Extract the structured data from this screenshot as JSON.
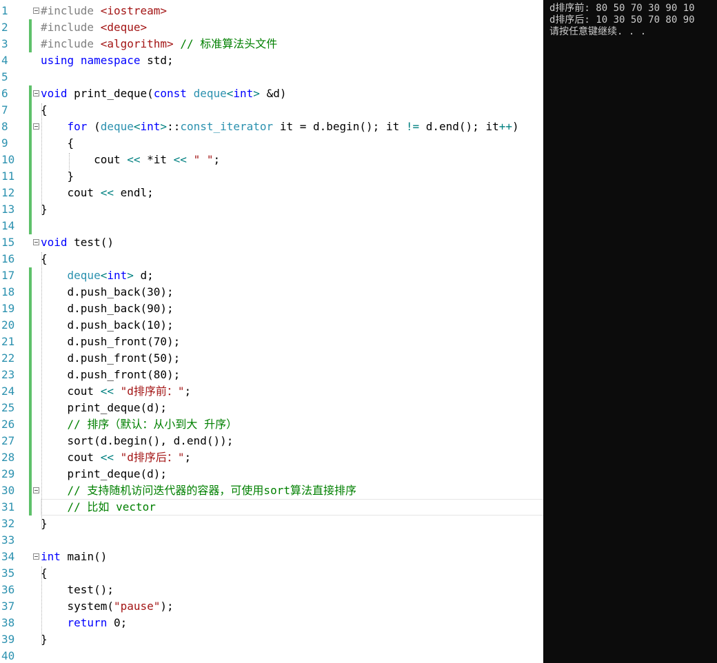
{
  "editor": {
    "lines": [
      {
        "n": "1",
        "text": "#include <iostream>",
        "fold": true,
        "green": false
      },
      {
        "n": "2",
        "text": "#include <deque>",
        "fold": false,
        "green": true
      },
      {
        "n": "3",
        "text": "#include <algorithm> // 标准算法头文件",
        "fold": false,
        "green": true
      },
      {
        "n": "4",
        "text": "using namespace std;",
        "fold": false,
        "green": false
      },
      {
        "n": "5",
        "text": "",
        "fold": false,
        "green": false
      },
      {
        "n": "6",
        "text": "void print_deque(const deque<int> &d)",
        "fold": true,
        "green": true
      },
      {
        "n": "7",
        "text": "{",
        "fold": false,
        "green": true
      },
      {
        "n": "8",
        "text": "    for (deque<int>::const_iterator it = d.begin(); it != d.end(); it++)",
        "fold": true,
        "green": true
      },
      {
        "n": "9",
        "text": "    {",
        "fold": false,
        "green": true
      },
      {
        "n": "10",
        "text": "        cout << *it << \" \";",
        "fold": false,
        "green": true
      },
      {
        "n": "11",
        "text": "    }",
        "fold": false,
        "green": true
      },
      {
        "n": "12",
        "text": "    cout << endl;",
        "fold": false,
        "green": true
      },
      {
        "n": "13",
        "text": "}",
        "fold": false,
        "green": true
      },
      {
        "n": "14",
        "text": "",
        "fold": false,
        "green": true
      },
      {
        "n": "15",
        "text": "void test()",
        "fold": true,
        "green": false
      },
      {
        "n": "16",
        "text": "{",
        "fold": false,
        "green": false
      },
      {
        "n": "17",
        "text": "    deque<int> d;",
        "fold": false,
        "green": true
      },
      {
        "n": "18",
        "text": "    d.push_back(30);",
        "fold": false,
        "green": true
      },
      {
        "n": "19",
        "text": "    d.push_back(90);",
        "fold": false,
        "green": true
      },
      {
        "n": "20",
        "text": "    d.push_back(10);",
        "fold": false,
        "green": true
      },
      {
        "n": "21",
        "text": "    d.push_front(70);",
        "fold": false,
        "green": true
      },
      {
        "n": "22",
        "text": "    d.push_front(50);",
        "fold": false,
        "green": true
      },
      {
        "n": "23",
        "text": "    d.push_front(80);",
        "fold": false,
        "green": true
      },
      {
        "n": "24",
        "text": "    cout << \"d排序前：\";",
        "fold": false,
        "green": true
      },
      {
        "n": "25",
        "text": "    print_deque(d);",
        "fold": false,
        "green": true
      },
      {
        "n": "26",
        "text": "    // 排序（默认：从小到大 升序）",
        "fold": false,
        "green": true
      },
      {
        "n": "27",
        "text": "    sort(d.begin(), d.end());",
        "fold": false,
        "green": true
      },
      {
        "n": "28",
        "text": "    cout << \"d排序后：\";",
        "fold": false,
        "green": true
      },
      {
        "n": "29",
        "text": "    print_deque(d);",
        "fold": false,
        "green": true
      },
      {
        "n": "30",
        "text": "    // 支持随机访问迭代器的容器，可使用sort算法直接排序",
        "fold": true,
        "green": true
      },
      {
        "n": "31",
        "text": "    // 比如 vector",
        "fold": false,
        "green": true
      },
      {
        "n": "32",
        "text": "}",
        "fold": false,
        "green": false
      },
      {
        "n": "33",
        "text": "",
        "fold": false,
        "green": false
      },
      {
        "n": "34",
        "text": "int main()",
        "fold": true,
        "green": false
      },
      {
        "n": "35",
        "text": "{",
        "fold": false,
        "green": false
      },
      {
        "n": "36",
        "text": "    test();",
        "fold": false,
        "green": false
      },
      {
        "n": "37",
        "text": "    system(\"pause\");",
        "fold": false,
        "green": false
      },
      {
        "n": "38",
        "text": "    return 0;",
        "fold": false,
        "green": false
      },
      {
        "n": "39",
        "text": "}",
        "fold": false,
        "green": false
      },
      {
        "n": "40",
        "text": "",
        "fold": false,
        "green": false
      }
    ]
  },
  "console": {
    "lines": [
      "d排序前: 80 50 70 30 90 10",
      "d排序后: 10 30 50 70 80 90",
      "请按任意键继续. . ."
    ]
  },
  "colors": {
    "keyword": "#0000ff",
    "type": "#2b91af",
    "string": "#a31515",
    "comment": "#008000",
    "preprocessor": "#808080",
    "operator": "#008080",
    "param": "#808080",
    "line_number": "#2b91af",
    "change_bar": "#5ec16a"
  }
}
